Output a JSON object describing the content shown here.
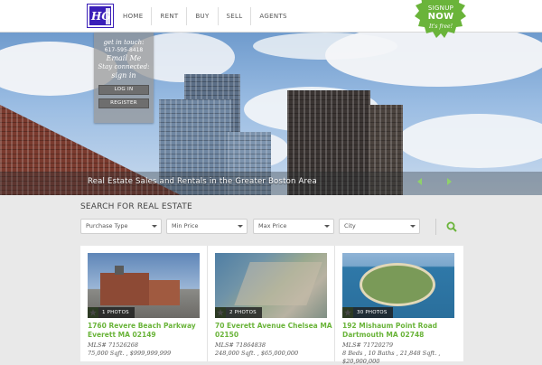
{
  "header": {
    "logo_text": "HG",
    "nav": [
      "HOME",
      "RENT",
      "BUY",
      "SELL",
      "AGENTS"
    ]
  },
  "signup": {
    "line1": "SIGNUP",
    "line2": "NOW",
    "line3": "It's free!",
    "color": "#6ab43a"
  },
  "contact_panel": {
    "get_in_touch": "get in touch:",
    "phone": "617-595-8418",
    "email": "Email Me",
    "stay_connected": "Stay connected:",
    "sign_in": "sign in",
    "login": "LOG IN",
    "register": "REGISTER"
  },
  "hero": {
    "caption": "Real Estate Sales and Rentals in the Greater Boston Area"
  },
  "search": {
    "title": "SEARCH FOR REAL ESTATE",
    "filters": [
      "Purchase Type",
      "Min Price",
      "Max Price",
      "City"
    ]
  },
  "accent_color": "#6ab43a",
  "listings": [
    {
      "photos": "1 PHOTOS",
      "address": "1760 Revere Beach Parkway Everett MA 02149",
      "mls": "MLS# 71526268",
      "details": "75,000 Sqft. ,  $999,999,999"
    },
    {
      "photos": "2 PHOTOS",
      "address": "70 Everett Avenue Chelsea MA 02150",
      "mls": "MLS# 71864838",
      "details": "248,000 Sqft. ,  $65,000,000"
    },
    {
      "photos": "30 PHOTOS",
      "address": "192 Mishaum Point Road Dartmouth MA 02748",
      "mls": "MLS# 71720279",
      "details": "8 Beds ,  10 Baths ,  21,848 Sqft. ,",
      "price": "$20,900,000"
    }
  ]
}
